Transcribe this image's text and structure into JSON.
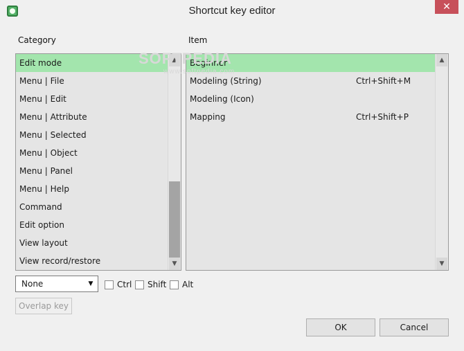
{
  "window": {
    "title": "Shortcut key editor",
    "app_icon": "app-icon",
    "close_label": "✕",
    "colors": {
      "selected_row": "#a3e5ad",
      "close_button": "#c7505a",
      "list_background": "#e5e5e5"
    }
  },
  "labels": {
    "category": "Category",
    "item": "Item"
  },
  "category_list": {
    "selected_index": 0,
    "items": [
      "Edit mode",
      "Menu | File",
      "Menu | Edit",
      "Menu | Attribute",
      "Menu | Selected",
      "Menu | Object",
      "Menu | Panel",
      "Menu | Help",
      "Command",
      "Edit option",
      "View layout",
      "View record/restore"
    ]
  },
  "item_list": {
    "selected_index": 0,
    "items": [
      {
        "name": "Beginner",
        "shortcut": ""
      },
      {
        "name": "Modeling (String)",
        "shortcut": "Ctrl+Shift+M"
      },
      {
        "name": "Modeling (Icon)",
        "shortcut": ""
      },
      {
        "name": "Mapping",
        "shortcut": "Ctrl+Shift+P"
      }
    ]
  },
  "key_select": {
    "value": "None"
  },
  "modifiers": {
    "ctrl": {
      "label": "Ctrl",
      "checked": false
    },
    "shift": {
      "label": "Shift",
      "checked": false
    },
    "alt": {
      "label": "Alt",
      "checked": false
    }
  },
  "buttons": {
    "overlap_key": "Overlap key",
    "ok": "OK",
    "cancel": "Cancel"
  },
  "watermark": {
    "text": "SOFTPEDIA",
    "subtext": "www.softpedia.com"
  }
}
